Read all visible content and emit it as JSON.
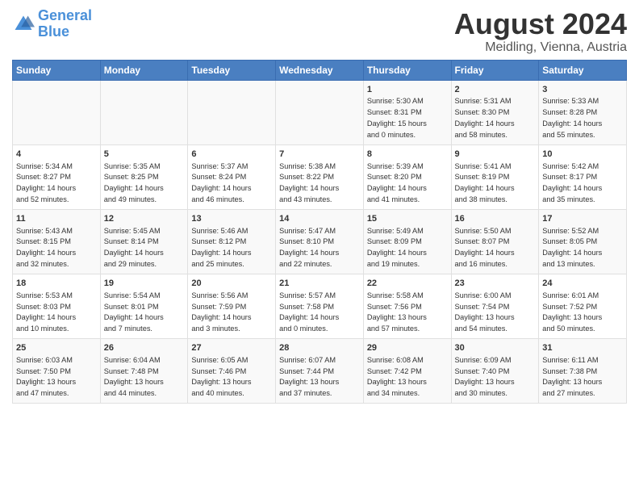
{
  "header": {
    "logo_general": "General",
    "logo_blue": "Blue",
    "main_title": "August 2024",
    "subtitle": "Meidling, Vienna, Austria"
  },
  "days_of_week": [
    "Sunday",
    "Monday",
    "Tuesday",
    "Wednesday",
    "Thursday",
    "Friday",
    "Saturday"
  ],
  "weeks": [
    [
      {
        "day": "",
        "info": ""
      },
      {
        "day": "",
        "info": ""
      },
      {
        "day": "",
        "info": ""
      },
      {
        "day": "",
        "info": ""
      },
      {
        "day": "1",
        "info": "Sunrise: 5:30 AM\nSunset: 8:31 PM\nDaylight: 15 hours\nand 0 minutes."
      },
      {
        "day": "2",
        "info": "Sunrise: 5:31 AM\nSunset: 8:30 PM\nDaylight: 14 hours\nand 58 minutes."
      },
      {
        "day": "3",
        "info": "Sunrise: 5:33 AM\nSunset: 8:28 PM\nDaylight: 14 hours\nand 55 minutes."
      }
    ],
    [
      {
        "day": "4",
        "info": "Sunrise: 5:34 AM\nSunset: 8:27 PM\nDaylight: 14 hours\nand 52 minutes."
      },
      {
        "day": "5",
        "info": "Sunrise: 5:35 AM\nSunset: 8:25 PM\nDaylight: 14 hours\nand 49 minutes."
      },
      {
        "day": "6",
        "info": "Sunrise: 5:37 AM\nSunset: 8:24 PM\nDaylight: 14 hours\nand 46 minutes."
      },
      {
        "day": "7",
        "info": "Sunrise: 5:38 AM\nSunset: 8:22 PM\nDaylight: 14 hours\nand 43 minutes."
      },
      {
        "day": "8",
        "info": "Sunrise: 5:39 AM\nSunset: 8:20 PM\nDaylight: 14 hours\nand 41 minutes."
      },
      {
        "day": "9",
        "info": "Sunrise: 5:41 AM\nSunset: 8:19 PM\nDaylight: 14 hours\nand 38 minutes."
      },
      {
        "day": "10",
        "info": "Sunrise: 5:42 AM\nSunset: 8:17 PM\nDaylight: 14 hours\nand 35 minutes."
      }
    ],
    [
      {
        "day": "11",
        "info": "Sunrise: 5:43 AM\nSunset: 8:15 PM\nDaylight: 14 hours\nand 32 minutes."
      },
      {
        "day": "12",
        "info": "Sunrise: 5:45 AM\nSunset: 8:14 PM\nDaylight: 14 hours\nand 29 minutes."
      },
      {
        "day": "13",
        "info": "Sunrise: 5:46 AM\nSunset: 8:12 PM\nDaylight: 14 hours\nand 25 minutes."
      },
      {
        "day": "14",
        "info": "Sunrise: 5:47 AM\nSunset: 8:10 PM\nDaylight: 14 hours\nand 22 minutes."
      },
      {
        "day": "15",
        "info": "Sunrise: 5:49 AM\nSunset: 8:09 PM\nDaylight: 14 hours\nand 19 minutes."
      },
      {
        "day": "16",
        "info": "Sunrise: 5:50 AM\nSunset: 8:07 PM\nDaylight: 14 hours\nand 16 minutes."
      },
      {
        "day": "17",
        "info": "Sunrise: 5:52 AM\nSunset: 8:05 PM\nDaylight: 14 hours\nand 13 minutes."
      }
    ],
    [
      {
        "day": "18",
        "info": "Sunrise: 5:53 AM\nSunset: 8:03 PM\nDaylight: 14 hours\nand 10 minutes."
      },
      {
        "day": "19",
        "info": "Sunrise: 5:54 AM\nSunset: 8:01 PM\nDaylight: 14 hours\nand 7 minutes."
      },
      {
        "day": "20",
        "info": "Sunrise: 5:56 AM\nSunset: 7:59 PM\nDaylight: 14 hours\nand 3 minutes."
      },
      {
        "day": "21",
        "info": "Sunrise: 5:57 AM\nSunset: 7:58 PM\nDaylight: 14 hours\nand 0 minutes."
      },
      {
        "day": "22",
        "info": "Sunrise: 5:58 AM\nSunset: 7:56 PM\nDaylight: 13 hours\nand 57 minutes."
      },
      {
        "day": "23",
        "info": "Sunrise: 6:00 AM\nSunset: 7:54 PM\nDaylight: 13 hours\nand 54 minutes."
      },
      {
        "day": "24",
        "info": "Sunrise: 6:01 AM\nSunset: 7:52 PM\nDaylight: 13 hours\nand 50 minutes."
      }
    ],
    [
      {
        "day": "25",
        "info": "Sunrise: 6:03 AM\nSunset: 7:50 PM\nDaylight: 13 hours\nand 47 minutes."
      },
      {
        "day": "26",
        "info": "Sunrise: 6:04 AM\nSunset: 7:48 PM\nDaylight: 13 hours\nand 44 minutes."
      },
      {
        "day": "27",
        "info": "Sunrise: 6:05 AM\nSunset: 7:46 PM\nDaylight: 13 hours\nand 40 minutes."
      },
      {
        "day": "28",
        "info": "Sunrise: 6:07 AM\nSunset: 7:44 PM\nDaylight: 13 hours\nand 37 minutes."
      },
      {
        "day": "29",
        "info": "Sunrise: 6:08 AM\nSunset: 7:42 PM\nDaylight: 13 hours\nand 34 minutes."
      },
      {
        "day": "30",
        "info": "Sunrise: 6:09 AM\nSunset: 7:40 PM\nDaylight: 13 hours\nand 30 minutes."
      },
      {
        "day": "31",
        "info": "Sunrise: 6:11 AM\nSunset: 7:38 PM\nDaylight: 13 hours\nand 27 minutes."
      }
    ]
  ]
}
